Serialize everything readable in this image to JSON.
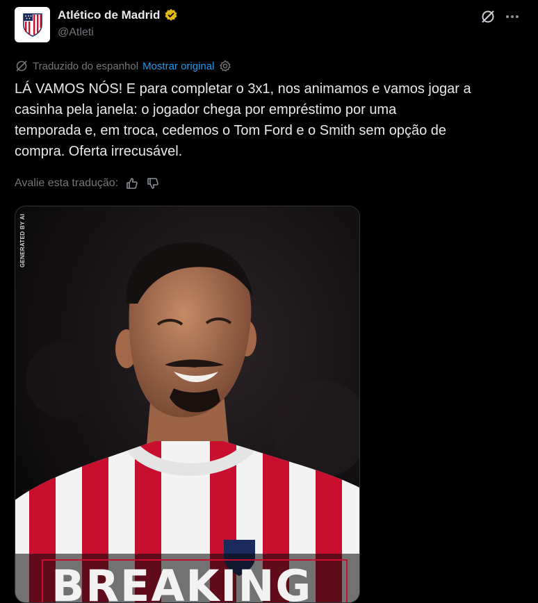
{
  "account": {
    "name": "Atlético de Madrid",
    "handle": "@Atleti",
    "avatar_icon": "atletico-crest",
    "verified_color": "#e2b719"
  },
  "header_icons": [
    "grok-icon",
    "more-icon"
  ],
  "translation": {
    "label": "Traduzido do espanhol",
    "show_original": "Mostrar original",
    "link_color": "#1d9bf0"
  },
  "tweet": {
    "text": "LÁ VAMOS NÓS! E para completar o 3x1, nos animamos e vamos jogar a\ncasinha pela janela: o jogador chega por empréstimo por uma\ntemporada e, em troca, cedemos o Tom Ford e o Smith sem opção de\ncompra. Oferta irrecusável."
  },
  "rate": {
    "label": "Avalie esta tradução:"
  },
  "media": {
    "ai_tag": "GENERATED BY AI",
    "headline": "BREAKING",
    "accent_color": "#c8102e"
  }
}
